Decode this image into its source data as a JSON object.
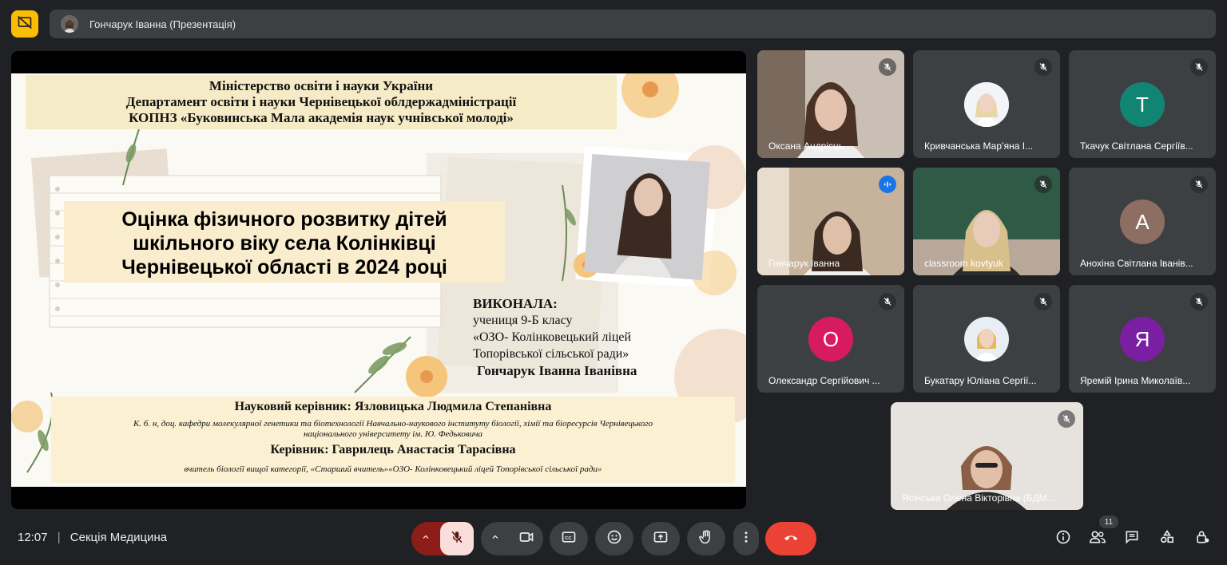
{
  "top": {
    "presenter_banner": "Гончарук Іванна (Презентація)"
  },
  "slide": {
    "header_lines": [
      "Міністерство освіти і науки України",
      "Департамент освіти і науки Чернівецької облдержадміністрації",
      "КОПНЗ «Буковинська Мала академія наук учнівської молоді»"
    ],
    "title_lines": [
      "Оцінка фізичного розвитку дітей",
      "шкільного віку села Колінківці",
      "Чернівецької області в 2024 році"
    ],
    "author_heading": "ВИКОНАЛА:",
    "author_lines": [
      "учениця 9-Б класу",
      "«ОЗО- Колінковецький ліцей",
      "Топорівської сільської ради»"
    ],
    "author_name": "Гончарук Іванна Іванівна",
    "supervisor": "Науковий керівник: Язловицька Людмила Степанівна",
    "supervisor_desc_1": "К. б. н, доц. кафедри молекулярної генетики та біотехнології Навчально-наукового інституту біології, хімії та біоресурсів Чернівецького",
    "supervisor_desc_2": "національного університету ім. Ю. Федьковича",
    "leader": "Керівник: Гаврилець Анастасія Тарасівна",
    "leader_desc": "вчитель біології вищої категорії, «Старший вчитель»«ОЗО- Колінковецький ліцей Топорівської сільської ради»"
  },
  "participants": [
    {
      "name": "Оксана Андрісць",
      "type": "video"
    },
    {
      "name": "Кривчанська Мар’яна І...",
      "type": "photo"
    },
    {
      "name": "Ткачук Світлана Сергіїв...",
      "letter": "Т",
      "color": "#128474"
    },
    {
      "name": "Гончарук Іванна",
      "type": "video",
      "speaking": true
    },
    {
      "name": "classroom kovtyuk",
      "type": "video"
    },
    {
      "name": "Анохіна Світлана Іванів...",
      "letter": "А",
      "color": "#8d6e63"
    },
    {
      "name": "Олександр Сергійович ...",
      "letter": "О",
      "color": "#d81b60"
    },
    {
      "name": "Букатару Юліана Сергії...",
      "type": "photo"
    },
    {
      "name": "Яремій Ірина Миколаїв...",
      "letter": "Я",
      "color": "#7b1fa2"
    },
    {
      "name": "Ясінська Олена Вікторівна (БДМ...",
      "type": "video"
    }
  ],
  "bottom": {
    "time": "12:07",
    "separator": "|",
    "meeting_name": "Секція Медицина",
    "people_count": "11"
  },
  "colors": {
    "background": "#202124",
    "tile": "#3c4043",
    "present_accent": "#fbbc04",
    "hangup": "#ea4335",
    "speaking": "#8ab4f8"
  }
}
